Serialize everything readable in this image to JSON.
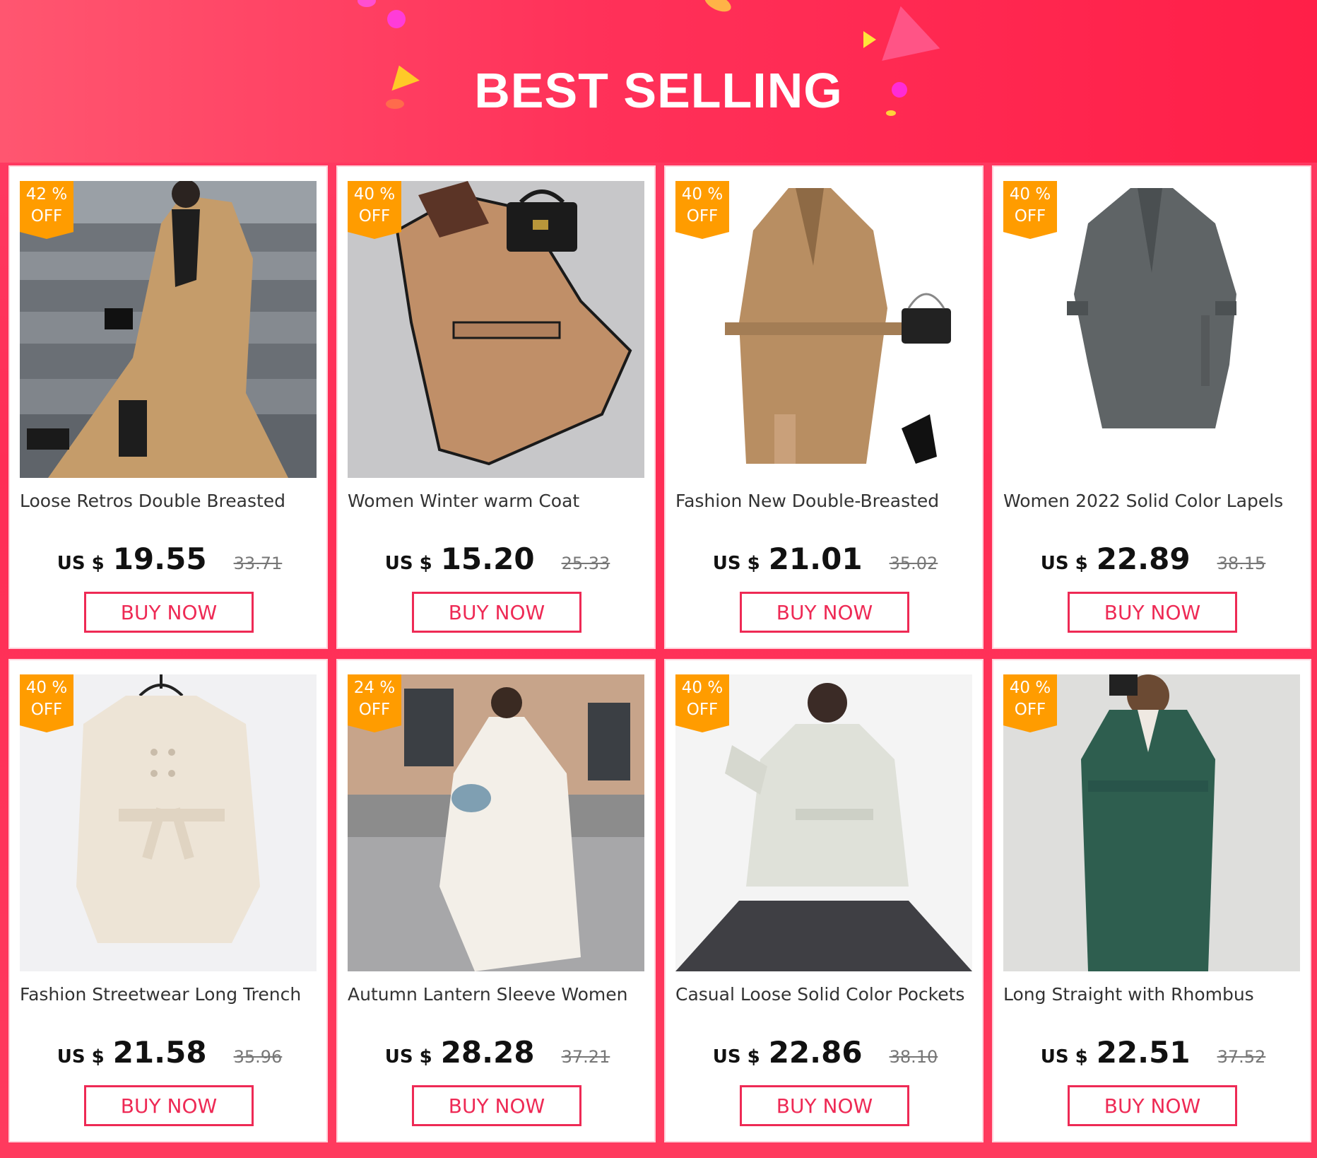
{
  "header": {
    "title": "BEST SELLING"
  },
  "currency_label": "US $",
  "buy_label": "BUY NOW",
  "accent_color": "#ff2d55",
  "badge_color": "#ff9c00",
  "products": [
    {
      "title": "Loose Retros Double Breasted",
      "price": "19.55",
      "old_price": "33.71",
      "discount": "42 %",
      "off": "OFF",
      "image": "beige-trench-coat-woman-sitting"
    },
    {
      "title": "Women Winter warm Coat",
      "price": "15.20",
      "old_price": "25.33",
      "discount": "40 %",
      "off": "OFF",
      "image": "camel-wool-coat-flatlay"
    },
    {
      "title": "Fashion New Double-Breasted",
      "price": "21.01",
      "old_price": "35.02",
      "discount": "40 %",
      "off": "OFF",
      "image": "khaki-trench-coat-on-hanger"
    },
    {
      "title": "Women 2022 Solid Color Lapels",
      "price": "22.89",
      "old_price": "38.15",
      "discount": "40 %",
      "off": "OFF",
      "image": "grey-trench-coat"
    },
    {
      "title": "Fashion Streetwear Long Trench",
      "price": "21.58",
      "old_price": "35.96",
      "discount": "40 %",
      "off": "OFF",
      "image": "white-trench-coat-on-hanger"
    },
    {
      "title": "Autumn Lantern Sleeve Women",
      "price": "28.28",
      "old_price": "37.21",
      "discount": "24 %",
      "off": "OFF",
      "image": "white-long-coat-street"
    },
    {
      "title": "Casual Loose Solid Color Pockets",
      "price": "22.86",
      "old_price": "38.10",
      "discount": "40 %",
      "off": "OFF",
      "image": "quilted-jacket-woman"
    },
    {
      "title": "Long Straight with Rhombus",
      "price": "22.51",
      "old_price": "37.52",
      "discount": "40 %",
      "off": "OFF",
      "image": "green-quilted-long-coat"
    }
  ]
}
